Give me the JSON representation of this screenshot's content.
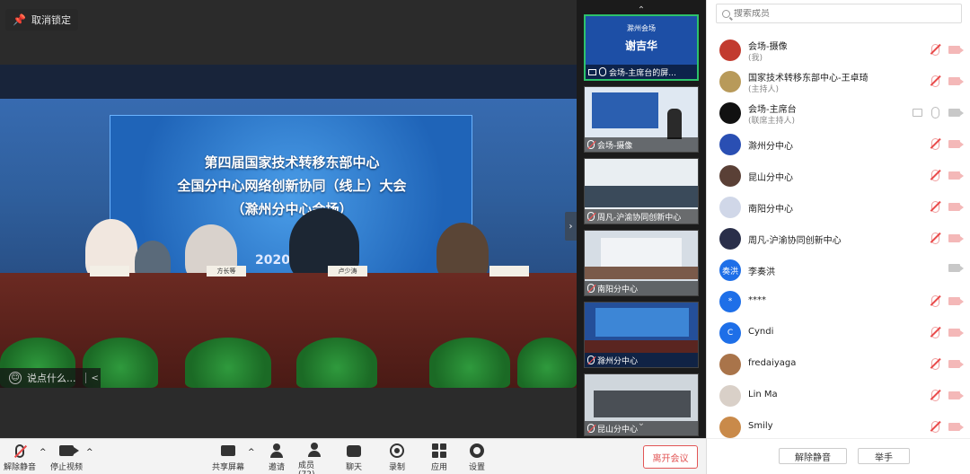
{
  "main": {
    "unlock_label": "取消锁定",
    "banner_lines": [
      "第四届国家技术转移东部中心",
      "全国分中心网络创新协同（线上）大会",
      "（滁州分中心会场）"
    ],
    "year_text": "2020",
    "nameplates": [
      "",
      "方长等",
      "卢少涛",
      ""
    ],
    "chat_placeholder": "说点什么..."
  },
  "gallery": {
    "thumbnails": [
      {
        "label": "会场-主席台的屏...",
        "muted": false,
        "active": true,
        "slide_lines": [
          "滁州会场",
          "谢吉华"
        ]
      },
      {
        "label": "会场-摄像",
        "muted": true,
        "active": false
      },
      {
        "label": "周凡-沪渝协同创新中心",
        "muted": true,
        "active": false
      },
      {
        "label": "南阳分中心",
        "muted": true,
        "active": false
      },
      {
        "label": "滁州分中心",
        "muted": true,
        "active": false
      },
      {
        "label": "昆山分中心",
        "muted": true,
        "active": false
      }
    ]
  },
  "panel": {
    "search_placeholder": "搜索成员",
    "members": [
      {
        "name": "会场-摄像",
        "role": "(我)",
        "avatar_color": "#c23b2f",
        "avatar_text": "",
        "mic": "muted",
        "cam": "off",
        "share": false
      },
      {
        "name": "国家技术转移东部中心-王卓琦",
        "role": "(主持人)",
        "avatar_color": "#b89a5a",
        "avatar_text": "",
        "mic": "muted",
        "cam": "off",
        "share": false
      },
      {
        "name": "会场-主席台",
        "role": "(联席主持人)",
        "avatar_color": "#111111",
        "avatar_text": "",
        "mic": "on",
        "cam": "on",
        "share": true
      },
      {
        "name": "滁州分中心",
        "role": "",
        "avatar_color": "#2a4fb3",
        "avatar_text": "",
        "mic": "muted",
        "cam": "off",
        "share": false
      },
      {
        "name": "昆山分中心",
        "role": "",
        "avatar_color": "#5a4036",
        "avatar_text": "",
        "mic": "muted",
        "cam": "off",
        "share": false
      },
      {
        "name": "南阳分中心",
        "role": "",
        "avatar_color": "#d0d7e8",
        "avatar_text": "",
        "mic": "muted",
        "cam": "off",
        "share": false
      },
      {
        "name": "周凡-沪渝协同创新中心",
        "role": "",
        "avatar_color": "#2a2f4a",
        "avatar_text": "",
        "mic": "muted",
        "cam": "off",
        "share": false
      },
      {
        "name": "李奏洪",
        "role": "",
        "avatar_color": "#1e6fe8",
        "avatar_text": "奏洪",
        "mic": "none",
        "cam": "on",
        "share": false
      },
      {
        "name": "****",
        "role": "",
        "avatar_color": "#1e6fe8",
        "avatar_text": "*",
        "mic": "muted",
        "cam": "off",
        "share": false
      },
      {
        "name": "Cyndi",
        "role": "",
        "avatar_color": "#1e6fe8",
        "avatar_text": "C",
        "mic": "muted",
        "cam": "off",
        "share": false
      },
      {
        "name": "fredaiyaga",
        "role": "",
        "avatar_color": "#a9744a",
        "avatar_text": "",
        "mic": "muted",
        "cam": "off",
        "share": false
      },
      {
        "name": "Lin Ma",
        "role": "",
        "avatar_color": "#d9d0c8",
        "avatar_text": "",
        "mic": "muted",
        "cam": "off",
        "share": false
      },
      {
        "name": "Smily",
        "role": "",
        "avatar_color": "#c98a4a",
        "avatar_text": "",
        "mic": "muted",
        "cam": "off",
        "share": false
      }
    ],
    "unmute_all_label": "解除静音",
    "raise_hand_label": "举手"
  },
  "toolbar": {
    "unmute_label": "解除静音",
    "stop_video_label": "停止视频",
    "share_label": "共享屏幕",
    "invite_label": "邀请",
    "members_label": "成员(72)",
    "chat_label": "聊天",
    "record_label": "录制",
    "apps_label": "应用",
    "settings_label": "设置",
    "leave_label": "离开会议"
  }
}
